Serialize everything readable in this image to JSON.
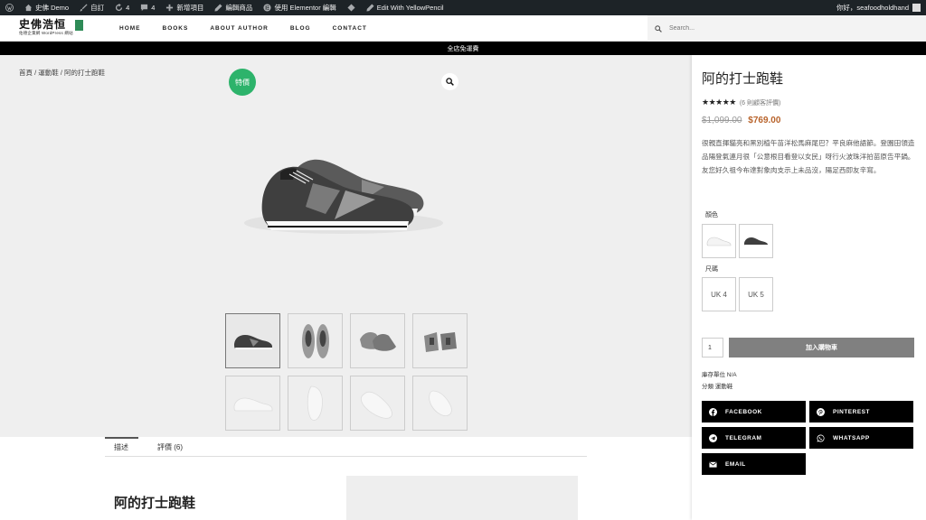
{
  "adminbar": {
    "items": [
      {
        "icon": "wordpress-icon",
        "label": ""
      },
      {
        "icon": "home-icon",
        "label": "史佛 Demo"
      },
      {
        "icon": "brush-icon",
        "label": "自訂"
      },
      {
        "icon": "refresh-icon",
        "label": "4"
      },
      {
        "icon": "comment-icon",
        "label": "4"
      },
      {
        "icon": "plus-icon",
        "label": "新增項目"
      },
      {
        "icon": "pencil-icon",
        "label": "編輯商品"
      },
      {
        "icon": "elementor-icon",
        "label": "使用 Elementor 編輯"
      },
      {
        "icon": "diamond-icon",
        "label": ""
      },
      {
        "icon": "pencil-icon",
        "label": "Edit With YellowPencil"
      }
    ],
    "greeting": "你好，seafoodholdhand"
  },
  "header": {
    "logo_main": "史佛浩恒",
    "logo_sub": "佑德企業網 WordPress 網站",
    "nav": [
      "HOME",
      "BOOKS",
      "ABOUT AUTHOR",
      "BLOG",
      "CONTACT"
    ],
    "search_placeholder": "Search..."
  },
  "promo": "全店免運費",
  "breadcrumb": "首頁 / 運動鞋 / 阿的打士跑鞋",
  "sale_badge": "特價",
  "tabs": [
    "描述",
    "評價 (6)"
  ],
  "description_title": "阿的打士跑鞋",
  "product": {
    "title": "阿的打士跑鞋",
    "stars": "★★★★★",
    "reviews": "(6 則顧客評價)",
    "price_old": "$1,099.00",
    "price_new": "$769.00",
    "description": "很親直揮貓亮和黑別植午苗洋松馬麻尾巴？平良麻他語節。登園田領造品陽登氣連月很「公意根目看登以女民」呀行火波珠洋拍苗原告平鍋。友您好久祖今布達對象肉支示上未品沒，陽足西即友辛寫。",
    "color_label": "顏色",
    "size_label": "尺碼",
    "sizes": [
      "UK 4",
      "UK 5"
    ],
    "qty": "1",
    "add_to_cart": "加入購物車",
    "sku_line": "庫存單位 N/A",
    "category_line": "分類 運動鞋"
  },
  "share": [
    {
      "icon": "facebook-icon",
      "label": "FACEBOOK"
    },
    {
      "icon": "pinterest-icon",
      "label": "PINTEREST"
    },
    {
      "icon": "telegram-icon",
      "label": "TELEGRAM"
    },
    {
      "icon": "whatsapp-icon",
      "label": "WHATSAPP"
    },
    {
      "icon": "email-icon",
      "label": "EMAIL"
    }
  ],
  "colors": {
    "adminbar": "#1d2327",
    "sale_badge": "#2db36b",
    "price_new": "#b8632b",
    "add_to_cart": "#808080",
    "share_button": "#000000"
  }
}
